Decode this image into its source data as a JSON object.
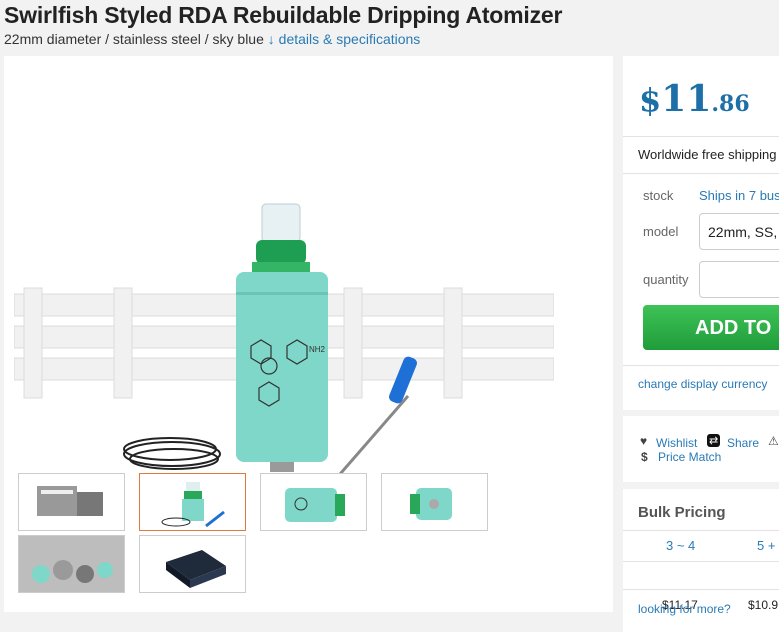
{
  "product": {
    "title": "Swirlfish Styled RDA Rebuildable Dripping Atomizer",
    "subtitle": "22mm diameter / stainless steel / sky blue",
    "details_link": "↓ details & specifications",
    "image_text": "NH2"
  },
  "price": {
    "currency_symbol": "$",
    "integer": "11",
    "cents": ".86",
    "accent_color": "#1d6fa8"
  },
  "purchase": {
    "shipping": "Worldwide free shipping",
    "stock_label": "stock",
    "stock_value": "Ships in 7 bus",
    "model_label": "model",
    "model_value": "22mm, SS,",
    "quantity_label": "quantity",
    "quantity_value": "",
    "add_button": "ADD TO",
    "add_button_color": "#2aab45",
    "currency_link": "change display currency"
  },
  "actions": {
    "wishlist": "Wishlist",
    "share": "Share",
    "price_match": "Price Match"
  },
  "bulk": {
    "title": "Bulk Pricing",
    "tiers": [
      {
        "qty": "3 ~ 4",
        "price": "$11.17"
      },
      {
        "qty": "5 +",
        "price": "$10.9"
      }
    ],
    "more_link": "looking for more?"
  }
}
